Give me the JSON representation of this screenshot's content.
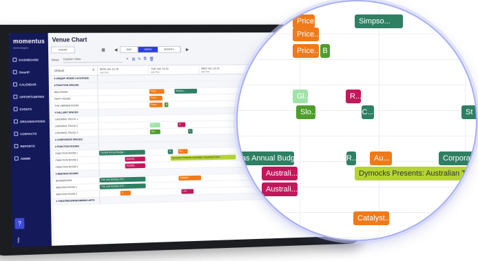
{
  "app": {
    "logo": "momentus",
    "logo_sub": "technologies",
    "page_title": "Venue Chart"
  },
  "sidebar": {
    "items": [
      {
        "label": "DASHBOARD",
        "icon": "grid-icon"
      },
      {
        "label": "SmartP",
        "icon": "chart-icon"
      },
      {
        "label": "CALENDAR",
        "icon": "calendar-icon"
      },
      {
        "label": "OPPORTUNITIES",
        "icon": "tag-icon"
      },
      {
        "label": "EVENTS",
        "icon": "star-icon"
      },
      {
        "label": "ORGANISATIONS",
        "icon": "building-icon"
      },
      {
        "label": "CONTACTS",
        "icon": "person-icon"
      },
      {
        "label": "REPORTS",
        "icon": "report-icon"
      },
      {
        "label": "ADMIN",
        "icon": "gear-icon"
      }
    ],
    "help_button": "?",
    "help_label": "Help"
  },
  "toolbar": {
    "today": "TODAY",
    "views": [
      "DAY",
      "WEEK",
      "MONTH"
    ],
    "active_view": "WEEK"
  },
  "filter": {
    "label": "Views",
    "value": "Custom View"
  },
  "grid": {
    "venue_header": "VENUE",
    "days": [
      {
        "label": "MON JUL 12 20",
        "sub": "AM    PM"
      },
      {
        "label": "TUE JUL 13 20",
        "sub": "AM    PM"
      },
      {
        "label": "WED JUL 14 20",
        "sub": "AM    PM"
      }
    ],
    "rows": [
      {
        "label": "▾ UNIQUE VENUE LOCATIONS",
        "group": true,
        "events": []
      },
      {
        "label": "▾ FUNCTION SPACES",
        "group": true,
        "events": []
      },
      {
        "label": "BALLROOM",
        "group": false,
        "events": [
          {
            "text": "Price...",
            "color": "orange",
            "start": 1.0,
            "len": 0.3
          },
          {
            "text": "Simpso...",
            "color": "green-dark",
            "start": 1.5,
            "len": 0.45
          }
        ]
      },
      {
        "label": "PARTY ROOM",
        "group": false,
        "events": [
          {
            "text": "Price...",
            "color": "orange",
            "start": 1.0,
            "len": 0.25
          }
        ]
      },
      {
        "label": "THE GARDEN ROOM",
        "group": false,
        "events": [
          {
            "text": "Price...",
            "color": "orange",
            "start": 1.0,
            "len": 0.25
          },
          {
            "text": "B",
            "color": "green",
            "start": 1.3,
            "len": 0.07
          }
        ]
      },
      {
        "label": "▾ GALLERY SPACES",
        "group": true,
        "events": []
      },
      {
        "label": "CATERING TRUCK 1",
        "group": false,
        "events": []
      },
      {
        "label": "CATERING TRUCK 2",
        "group": false,
        "events": [
          {
            "text": "Gl...",
            "color": "mint",
            "start": 1.0,
            "len": 0.2
          },
          {
            "text": "R...",
            "color": "crimson",
            "start": 1.55,
            "len": 0.15
          }
        ]
      },
      {
        "label": "CATERING TRUCK 3",
        "group": false,
        "events": [
          {
            "text": "Slo...",
            "color": "green",
            "start": 1.0,
            "len": 0.2
          },
          {
            "text": "C...",
            "color": "green-dark",
            "start": 1.75,
            "len": 0.1
          }
        ]
      },
      {
        "label": "▾ CORPORATE SPACES",
        "group": true,
        "events": []
      },
      {
        "label": "▾ FUNCTION ROOMS",
        "group": true,
        "events": []
      },
      {
        "label": "FUNCTION ROOM 1",
        "group": false,
        "events": [
          {
            "text": "Central Annual Budge...",
            "color": "green-dark",
            "start": 0.0,
            "len": 0.9
          },
          {
            "text": "R...",
            "color": "green-dark",
            "start": 1.35,
            "len": 0.1
          },
          {
            "text": "Au...",
            "color": "orange",
            "start": 1.55,
            "len": 0.2
          }
        ]
      },
      {
        "label": "FUNCTION ROOM 2",
        "group": false,
        "events": [
          {
            "text": "Australi...",
            "color": "crimson",
            "start": 0.5,
            "len": 0.4
          },
          {
            "text": "Dymocks Presents: Australian Travelling Exhib...",
            "color": "lime",
            "start": 1.4,
            "len": 1.3
          }
        ]
      },
      {
        "label": "FUNCTION ROOM 3",
        "group": false,
        "events": [
          {
            "text": "Australi...",
            "color": "crimson",
            "start": 0.5,
            "len": 0.4
          }
        ]
      },
      {
        "label": "▾ MEETING ROOMS",
        "group": true,
        "events": []
      },
      {
        "label": "BOARDROOM",
        "group": false,
        "events": [
          {
            "text": "The Law Society of N...",
            "color": "green-dark",
            "start": 0.0,
            "len": 0.9
          },
          {
            "text": "Catalyst...",
            "color": "orange",
            "start": 1.55,
            "len": 0.45
          }
        ]
      },
      {
        "label": "MEETING ROOM 1",
        "group": false,
        "events": [
          {
            "text": "The Law Society of N...",
            "color": "green-dark",
            "start": 0.0,
            "len": 0.9
          }
        ]
      },
      {
        "label": "MEETING ROOM 2",
        "group": false,
        "events": [
          {
            "text": "C...",
            "color": "orange",
            "start": 0.4,
            "len": 0.2
          },
          {
            "text": "L M...",
            "color": "crimson",
            "start": 1.6,
            "len": 0.25
          }
        ]
      },
      {
        "label": "▾ THEATRES/PERFORMING ARTS",
        "group": true,
        "events": []
      }
    ]
  },
  "lens": {
    "events": [
      {
        "text": "Price...",
        "color": "orange",
        "row": 0
      },
      {
        "text": "Simpso...",
        "color": "green-dark",
        "row": 0
      },
      {
        "text": "Price...",
        "color": "orange",
        "row": 1
      },
      {
        "text": "Price...",
        "color": "orange",
        "row": 2
      },
      {
        "text": "B",
        "color": "green",
        "row": 2
      },
      {
        "text": "Gl...",
        "color": "mint",
        "row": 3
      },
      {
        "text": "R...",
        "color": "crimson",
        "row": 3
      },
      {
        "text": "Slo...",
        "color": "green",
        "row": 4
      },
      {
        "text": "C...",
        "color": "green-dark",
        "row": 4
      },
      {
        "text": "St",
        "color": "green-dark",
        "row": 4
      },
      {
        "text": "as Annual Budge...",
        "color": "green-dark",
        "row": 6
      },
      {
        "text": "R...",
        "color": "green-dark",
        "row": 6
      },
      {
        "text": "Au...",
        "color": "orange",
        "row": 6
      },
      {
        "text": "Corporat",
        "color": "green-dark",
        "row": 6
      },
      {
        "text": "Australi...",
        "color": "crimson",
        "row": 7
      },
      {
        "text": "Dymocks Presents: Australian Travelling",
        "color": "lime",
        "row": 7
      },
      {
        "text": "Australi...",
        "color": "crimson",
        "row": 8
      },
      {
        "text": "Catalyst...",
        "color": "orange",
        "row": 9
      }
    ]
  },
  "colors": {
    "orange": "#ef7a1a",
    "green-dark": "#2f7f63",
    "green": "#4f9d2d",
    "crimson": "#c2185b",
    "mint": "#9fe3a8",
    "lime": "#b5d334",
    "sidebar": "#14195a",
    "accent": "#2c3ee0"
  }
}
